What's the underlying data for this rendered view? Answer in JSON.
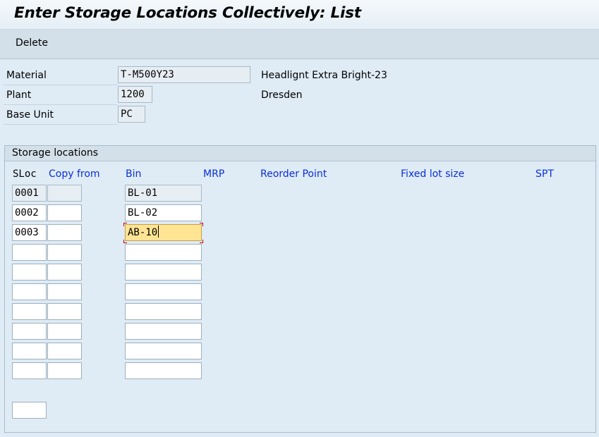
{
  "title": "Enter Storage Locations Collectively: List",
  "toolbar": {
    "delete_label": "Delete"
  },
  "header": {
    "material_label": "Material",
    "material_value": "T-M500Y23",
    "material_desc": "Headlignt Extra Bright-23",
    "plant_label": "Plant",
    "plant_value": "1200",
    "plant_desc": "Dresden",
    "base_unit_label": "Base Unit",
    "base_unit_value": "PC"
  },
  "storage": {
    "group_title": "Storage locations",
    "columns": {
      "sloc": "SLoc",
      "copy_from": "Copy from",
      "bin": "Bin",
      "mrp": "MRP",
      "reorder_point": "Reorder Point",
      "fixed_lot_size": "Fixed lot size",
      "spt": "SPT"
    },
    "rows": [
      {
        "sloc": "0001",
        "copy_from": "",
        "bin": "BL-01"
      },
      {
        "sloc": "0002",
        "copy_from": "",
        "bin": "BL-02"
      },
      {
        "sloc": "0003",
        "copy_from": "",
        "bin": "AB-10"
      },
      {
        "sloc": "",
        "copy_from": "",
        "bin": ""
      },
      {
        "sloc": "",
        "copy_from": "",
        "bin": ""
      },
      {
        "sloc": "",
        "copy_from": "",
        "bin": ""
      },
      {
        "sloc": "",
        "copy_from": "",
        "bin": ""
      },
      {
        "sloc": "",
        "copy_from": "",
        "bin": ""
      },
      {
        "sloc": "",
        "copy_from": "",
        "bin": ""
      },
      {
        "sloc": "",
        "copy_from": "",
        "bin": ""
      }
    ],
    "bottom_field": ""
  },
  "colors": {
    "accent_header_text": "#0a2fd6",
    "focused_field": "#ffe494",
    "background": "#dfebf5"
  }
}
